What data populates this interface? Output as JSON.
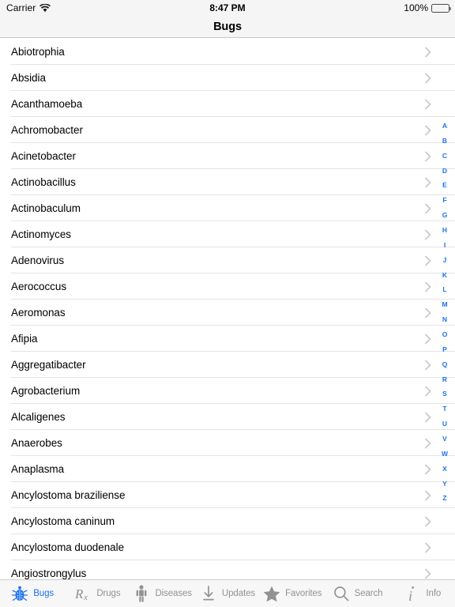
{
  "status_bar": {
    "carrier": "Carrier",
    "wifi_icon": "wifi-icon",
    "time": "8:47 PM",
    "battery_percent": "100%",
    "battery_icon": "battery-full-icon"
  },
  "nav": {
    "title": "Bugs"
  },
  "list": {
    "chevron_icon": "chevron-right-icon",
    "rows": [
      {
        "label": "Abiotrophia"
      },
      {
        "label": "Absidia"
      },
      {
        "label": "Acanthamoeba"
      },
      {
        "label": "Achromobacter"
      },
      {
        "label": "Acinetobacter"
      },
      {
        "label": "Actinobacillus"
      },
      {
        "label": "Actinobaculum"
      },
      {
        "label": "Actinomyces"
      },
      {
        "label": "Adenovirus"
      },
      {
        "label": "Aerococcus"
      },
      {
        "label": "Aeromonas"
      },
      {
        "label": "Afipia"
      },
      {
        "label": "Aggregatibacter"
      },
      {
        "label": "Agrobacterium"
      },
      {
        "label": "Alcaligenes"
      },
      {
        "label": "Anaerobes"
      },
      {
        "label": "Anaplasma"
      },
      {
        "label": "Ancylostoma braziliense"
      },
      {
        "label": "Ancylostoma caninum"
      },
      {
        "label": "Ancylostoma duodenale"
      },
      {
        "label": "Angiostrongylus"
      }
    ]
  },
  "section_index": {
    "accent_color": "#1a72f2",
    "letters": [
      "A",
      "B",
      "C",
      "D",
      "E",
      "F",
      "G",
      "H",
      "I",
      "J",
      "K",
      "L",
      "M",
      "N",
      "O",
      "P",
      "Q",
      "R",
      "S",
      "T",
      "U",
      "V",
      "W",
      "X",
      "Y",
      "Z"
    ]
  },
  "tab_bar": {
    "active_color": "#1a72f2",
    "inactive_color": "#929292",
    "tabs": [
      {
        "label": "Bugs",
        "icon": "bug-icon",
        "active": true
      },
      {
        "label": "Drugs",
        "icon": "rx-icon",
        "active": false
      },
      {
        "label": "Diseases",
        "icon": "person-icon",
        "active": false
      },
      {
        "label": "Updates",
        "icon": "download-icon",
        "active": false
      },
      {
        "label": "Favorites",
        "icon": "star-icon",
        "active": false
      },
      {
        "label": "Search",
        "icon": "search-icon",
        "active": false
      },
      {
        "label": "Info",
        "icon": "info-icon",
        "active": false
      }
    ]
  }
}
